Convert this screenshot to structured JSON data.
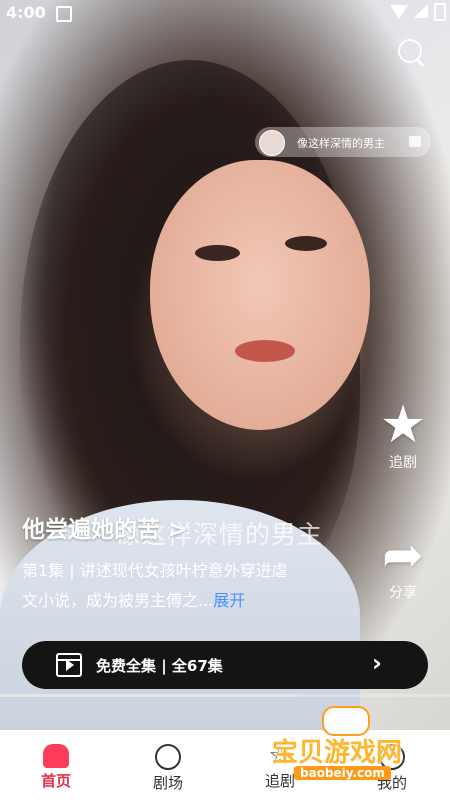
{
  "status_bar": {
    "time": "4:00"
  },
  "video": {
    "inset_caption": "像这样深情的男主",
    "overlay_subtitle": "像这样深情的男主",
    "title": "他尝遍她的苦 >",
    "description": "第1集 | 讲述现代女孩叶柠意外穿进虐文小说，成为被男主傅之...",
    "expand_label": "展开",
    "progress_fraction": 0.66
  },
  "side_actions": {
    "follow_label": "追剧",
    "share_label": "分享"
  },
  "episodes_bar": {
    "label": "免费全集 | 全67集",
    "chevron": "›"
  },
  "tabs": [
    {
      "label": "首页",
      "active": true
    },
    {
      "label": "剧场",
      "active": false
    },
    {
      "label": "追剧",
      "active": false
    },
    {
      "label": "我的",
      "active": false
    }
  ],
  "watermark": {
    "title": "宝贝游戏网",
    "url": "baobeiy.com"
  },
  "icons": {
    "search": "search-icon",
    "follow": "star-icon",
    "share": "share-arrow-icon",
    "play": "play-icon"
  },
  "colors": {
    "accent": "#ff3b5c",
    "link": "#4a90ff",
    "bar": "#141414"
  }
}
